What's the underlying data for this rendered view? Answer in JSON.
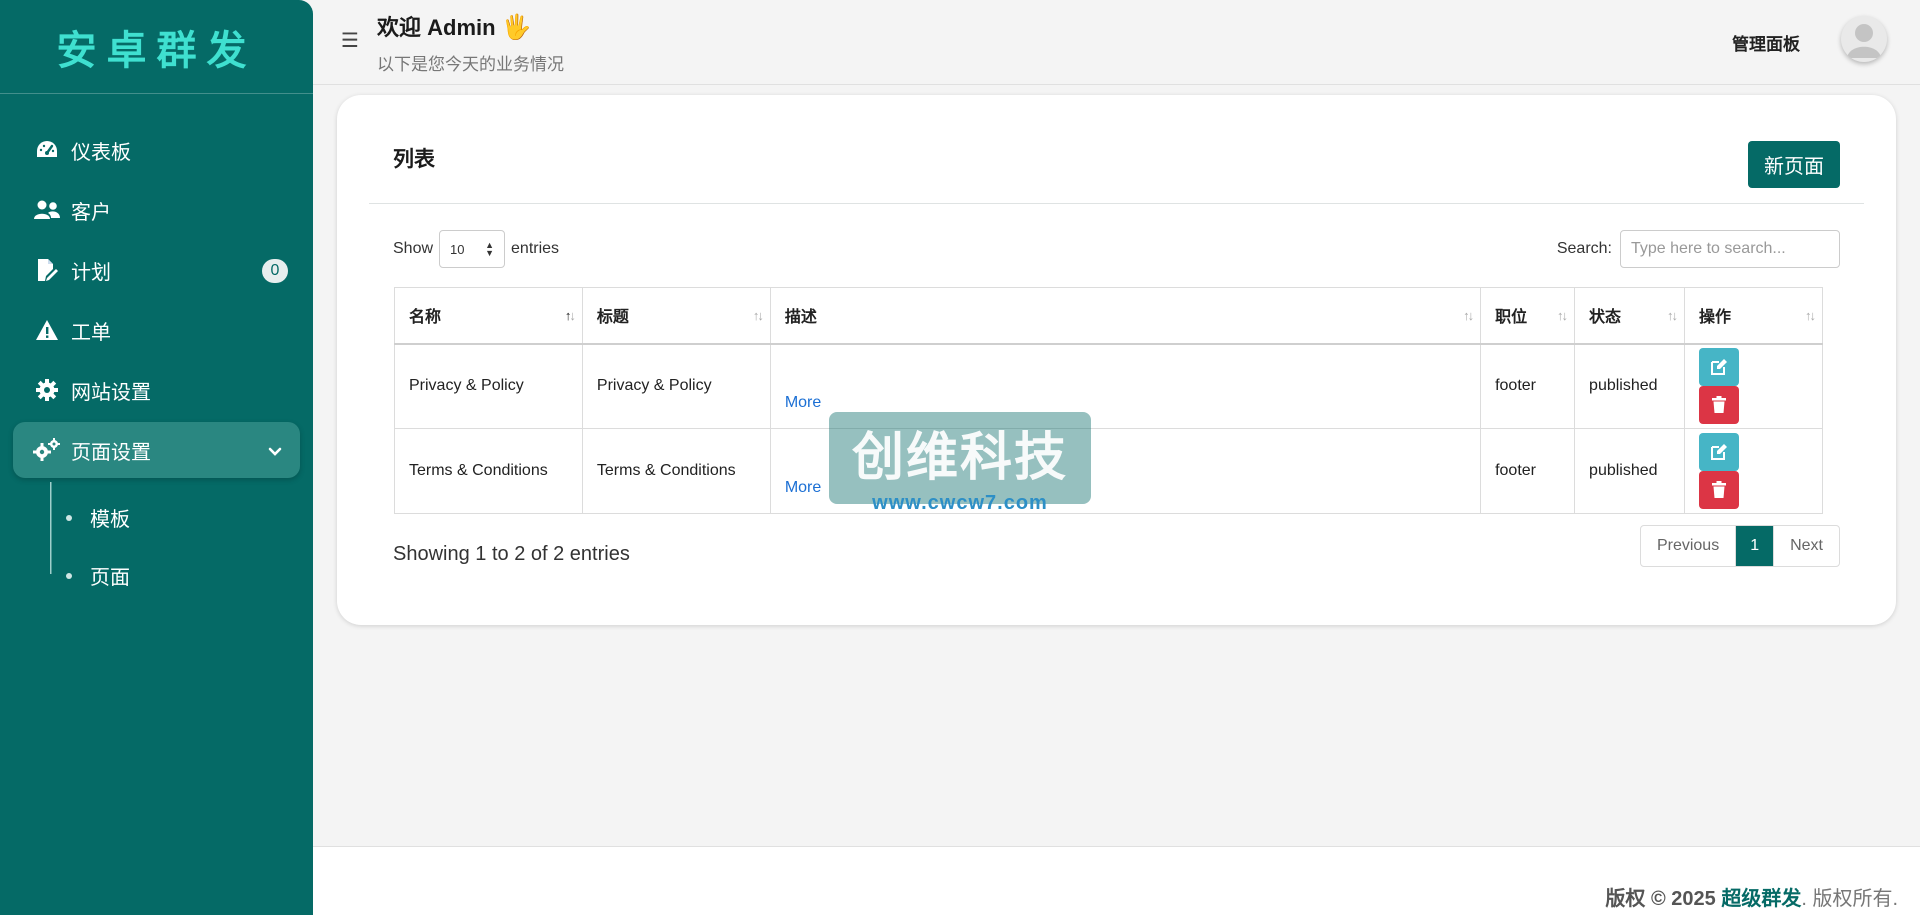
{
  "brand": "安卓群发",
  "sidebar": {
    "items": [
      {
        "label": "仪表板",
        "icon": "gauge-icon"
      },
      {
        "label": "客户",
        "icon": "users-icon"
      },
      {
        "label": "计划",
        "icon": "edit-document-icon",
        "badge": "0"
      },
      {
        "label": "工单",
        "icon": "warning-icon"
      },
      {
        "label": "网站设置",
        "icon": "gear-icon"
      },
      {
        "label": "页面设置",
        "icon": "gears-icon",
        "active": true
      }
    ],
    "subitems": [
      {
        "label": "模板"
      },
      {
        "label": "页面"
      }
    ]
  },
  "header": {
    "welcome": "欢迎 Admin",
    "wave": "🖐",
    "subtitle": "以下是您今天的业务情况",
    "admin_panel": "管理面板"
  },
  "card": {
    "title": "列表",
    "new_button": "新页面",
    "show_label": "Show",
    "entries_value": "10",
    "entries_label": "entries",
    "search_label": "Search:",
    "search_placeholder": "Type here to search...",
    "columns": [
      "名称",
      "标题",
      "描述",
      "职位",
      "状态",
      "操作"
    ],
    "rows": [
      {
        "name": "Privacy & Policy",
        "title": "Privacy & Policy",
        "more": "More",
        "position": "footer",
        "status": "published"
      },
      {
        "name": "Terms & Conditions",
        "title": "Terms & Conditions",
        "more": "More",
        "position": "footer",
        "status": "published"
      }
    ],
    "showing": "Showing 1 to 2 of 2 entries",
    "pager": {
      "prev": "Previous",
      "current": "1",
      "next": "Next"
    }
  },
  "watermark": {
    "title": "创维科技",
    "url": "www.cwcw7.com"
  },
  "footer": {
    "prefix": "版权 © 2025 ",
    "brand": "超级群发",
    "suffix": ". 版权所有."
  },
  "colors": {
    "primary": "#056a66",
    "accent": "#3fe0d0",
    "edit": "#46b5c6",
    "delete": "#dc3545",
    "link": "#1b6fd4"
  }
}
